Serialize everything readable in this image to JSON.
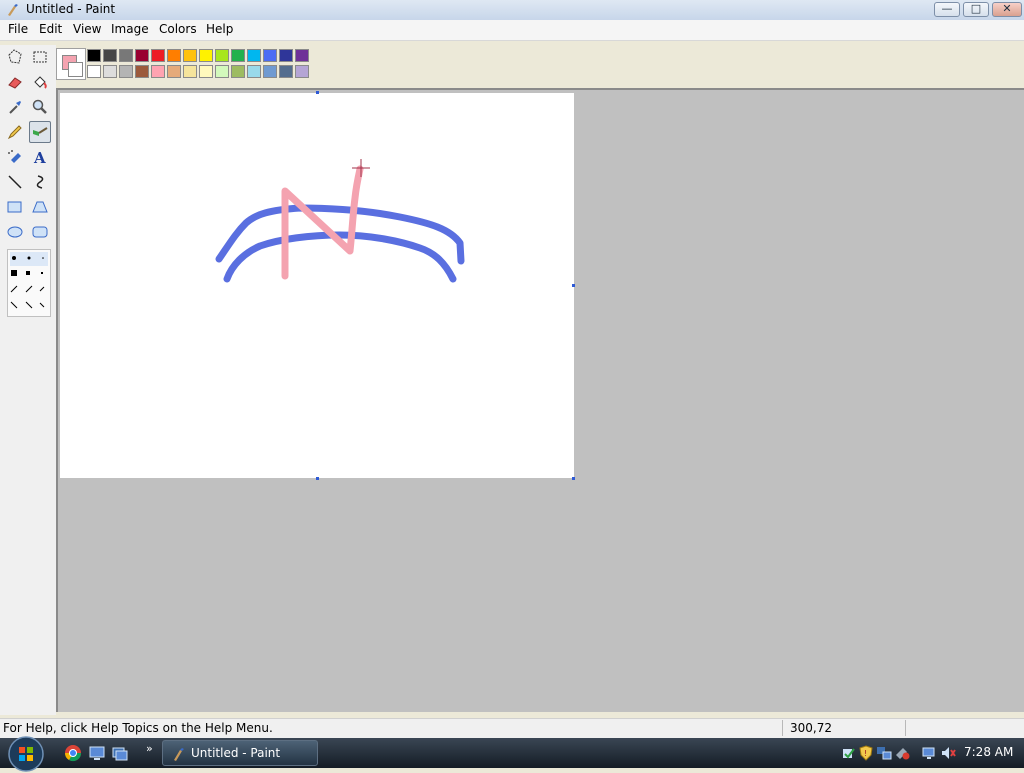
{
  "window": {
    "title": "Untitled - Paint"
  },
  "menu": [
    "File",
    "Edit",
    "View",
    "Image",
    "Colors",
    "Help"
  ],
  "tools": [
    "free-form-select",
    "rectangle-select",
    "eraser",
    "fill",
    "pick-color",
    "magnifier",
    "pencil",
    "brush",
    "airbrush",
    "text",
    "line",
    "curve",
    "rectangle",
    "polygon",
    "ellipse",
    "rounded-rectangle"
  ],
  "selected_tool": "brush",
  "palette": {
    "foreground": "#f4a3b0",
    "background": "#ffffff",
    "row1": [
      "#000000",
      "#464646",
      "#787878",
      "#990030",
      "#ed1c24",
      "#ff7e00",
      "#ffc20e",
      "#fff200",
      "#a8e61d",
      "#22b14c",
      "#00b7ef",
      "#4d6df3",
      "#2f3699",
      "#6f3198"
    ],
    "row2": [
      "#ffffff",
      "#dcdcdc",
      "#b4b4b4",
      "#9c5a3c",
      "#ffa3b1",
      "#e5aa7a",
      "#f5e49c",
      "#fff9bd",
      "#d3f9bc",
      "#9dbb61",
      "#99d9ea",
      "#709ad1",
      "#546d8e",
      "#b5a5d5"
    ]
  },
  "drawing": {
    "stroke_colors": [
      "#5a6fe0",
      "#f4a3b0"
    ]
  },
  "status": {
    "help_text": "For Help, click Help Topics on the Help Menu.",
    "coordinates": "300,72"
  },
  "taskbar": {
    "task_label": "Untitled - Paint",
    "clock": "7:28 AM"
  }
}
